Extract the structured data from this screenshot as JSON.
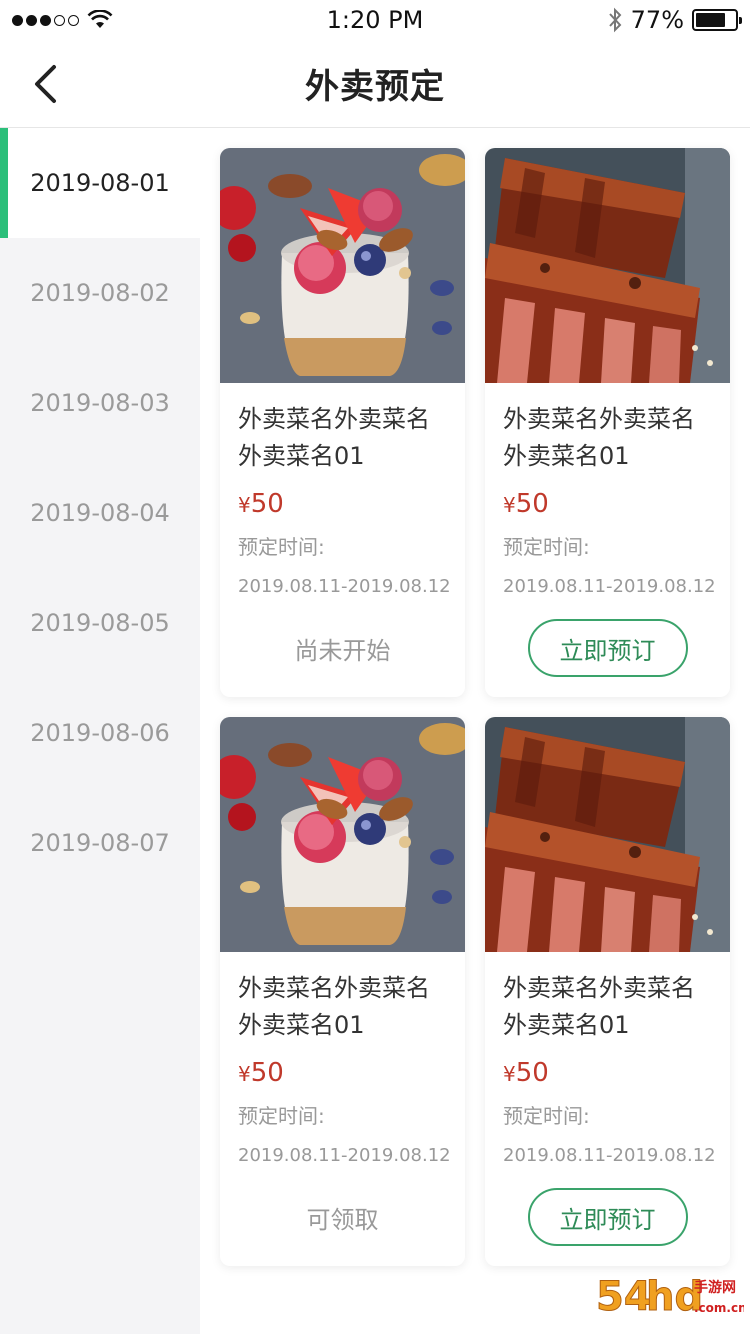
{
  "status_bar": {
    "time": "1:20 PM",
    "battery_text": "77%",
    "battery_level": 0.77
  },
  "nav": {
    "title": "外卖预定"
  },
  "sidebar": {
    "dates": [
      {
        "label": "2019-08-01",
        "active": true
      },
      {
        "label": "2019-08-02",
        "active": false
      },
      {
        "label": "2019-08-03",
        "active": false
      },
      {
        "label": "2019-08-04",
        "active": false
      },
      {
        "label": "2019-08-05",
        "active": false
      },
      {
        "label": "2019-08-06",
        "active": false
      },
      {
        "label": "2019-08-07",
        "active": false
      }
    ]
  },
  "cards": [
    {
      "image": "parfait-photo",
      "name": "外卖菜名外卖菜名外卖菜名01",
      "currency": "¥",
      "price": "50",
      "reserve_label": "预定时间:",
      "reserve_time": "2019.08.11-2019.08.12",
      "action_type": "text",
      "action_label": "尚未开始"
    },
    {
      "image": "ribs-photo",
      "name": "外卖菜名外卖菜名外卖菜名01",
      "currency": "¥",
      "price": "50",
      "reserve_label": "预定时间:",
      "reserve_time": "2019.08.11-2019.08.12",
      "action_type": "button",
      "action_label": "立即预订"
    },
    {
      "image": "parfait-photo",
      "name": "外卖菜名外卖菜名外卖菜名01",
      "currency": "¥",
      "price": "50",
      "reserve_label": "预定时间:",
      "reserve_time": "2019.08.11-2019.08.12",
      "action_type": "text",
      "action_label": "可领取"
    },
    {
      "image": "ribs-photo",
      "name": "外卖菜名外卖菜名外卖菜名01",
      "currency": "¥",
      "price": "50",
      "reserve_label": "预定时间:",
      "reserve_time": "2019.08.11-2019.08.12",
      "action_type": "button",
      "action_label": "立即预订"
    }
  ],
  "watermark": {
    "text": "54hd手游网",
    "sub": ".com.cn"
  },
  "colors": {
    "accent": "#2bbf7a",
    "button_border": "#3aa36b",
    "price": "#c0392b",
    "sidebar_bg": "#f4f4f6"
  }
}
